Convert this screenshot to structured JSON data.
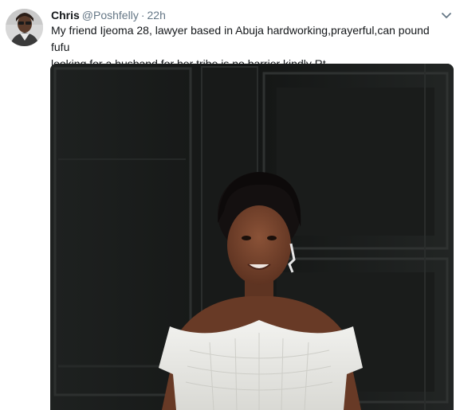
{
  "tweet": {
    "author": {
      "display_name": "Chris",
      "handle": "@Poshfelly",
      "avatar_icon": "user-avatar"
    },
    "separator": "·",
    "time": "22h",
    "menu_icon": "chevron-down-icon",
    "text": "My friend Ijeoma 28, lawyer based in Abuja hardworking,prayerful,can pound fufu\nlooking for a husband for her tribe is no barrier kindly Rt",
    "media": {
      "kind": "photo",
      "subject": "woman in white off-shoulder top"
    }
  },
  "colors": {
    "text_primary": "#14171a",
    "text_secondary": "#657786",
    "background": "#ffffff"
  }
}
